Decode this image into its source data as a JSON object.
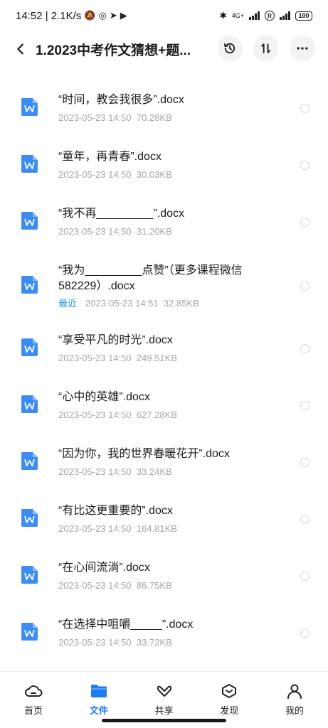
{
  "status_bar": {
    "time_speed": "14:52 | 2.1K/s",
    "network": "4G+",
    "battery": "100",
    "reg_mark": "R"
  },
  "header": {
    "title": "1.2023中考作文猜想+题..."
  },
  "files": [
    {
      "name": "“时间，教会我很多”.docx",
      "date": "2023-05-23  14:50",
      "size": "70.28KB"
    },
    {
      "name": "“童年，再青春”.docx",
      "date": "2023-05-23  14:50",
      "size": "30.03KB"
    },
    {
      "name": "“我不再_________”.docx",
      "date": "2023-05-23  14:50",
      "size": "31.20KB"
    },
    {
      "name": "“我为_________点赞”（更多课程微信582229）.docx",
      "badge": "最近",
      "date": "2023-05-23  14:51",
      "size": "32.85KB"
    },
    {
      "name": "“享受平凡的时光”.docx",
      "date": "2023-05-23  14:50",
      "size": "249.51KB"
    },
    {
      "name": "“心中的英雄”.docx",
      "date": "2023-05-23  14:50",
      "size": "627.28KB"
    },
    {
      "name": "“因为你，我的世界春暖花开”.docx",
      "date": "2023-05-23  14:50",
      "size": "33.24KB"
    },
    {
      "name": "“有比这更重要的”.docx",
      "date": "2023-05-23  14:50",
      "size": "164.81KB"
    },
    {
      "name": "“在心间流淌”.docx",
      "date": "2023-05-23  14:50",
      "size": "86.75KB"
    },
    {
      "name": "“在选择中咀嚼_____”.docx",
      "date": "2023-05-23  14:50",
      "size": "33.72KB"
    }
  ],
  "nav": [
    {
      "label": "首页",
      "icon": "cloud-icon"
    },
    {
      "label": "文件",
      "icon": "folder-icon",
      "active": true
    },
    {
      "label": "共享",
      "icon": "share-icon"
    },
    {
      "label": "发现",
      "icon": "discover-icon"
    },
    {
      "label": "我的",
      "icon": "profile-icon"
    }
  ],
  "colors": {
    "accent": "#1c7cf0",
    "recent_badge": "#1d9bd8",
    "doc_icon": "#3b8cf5",
    "meta_text": "#a3a6ad"
  }
}
